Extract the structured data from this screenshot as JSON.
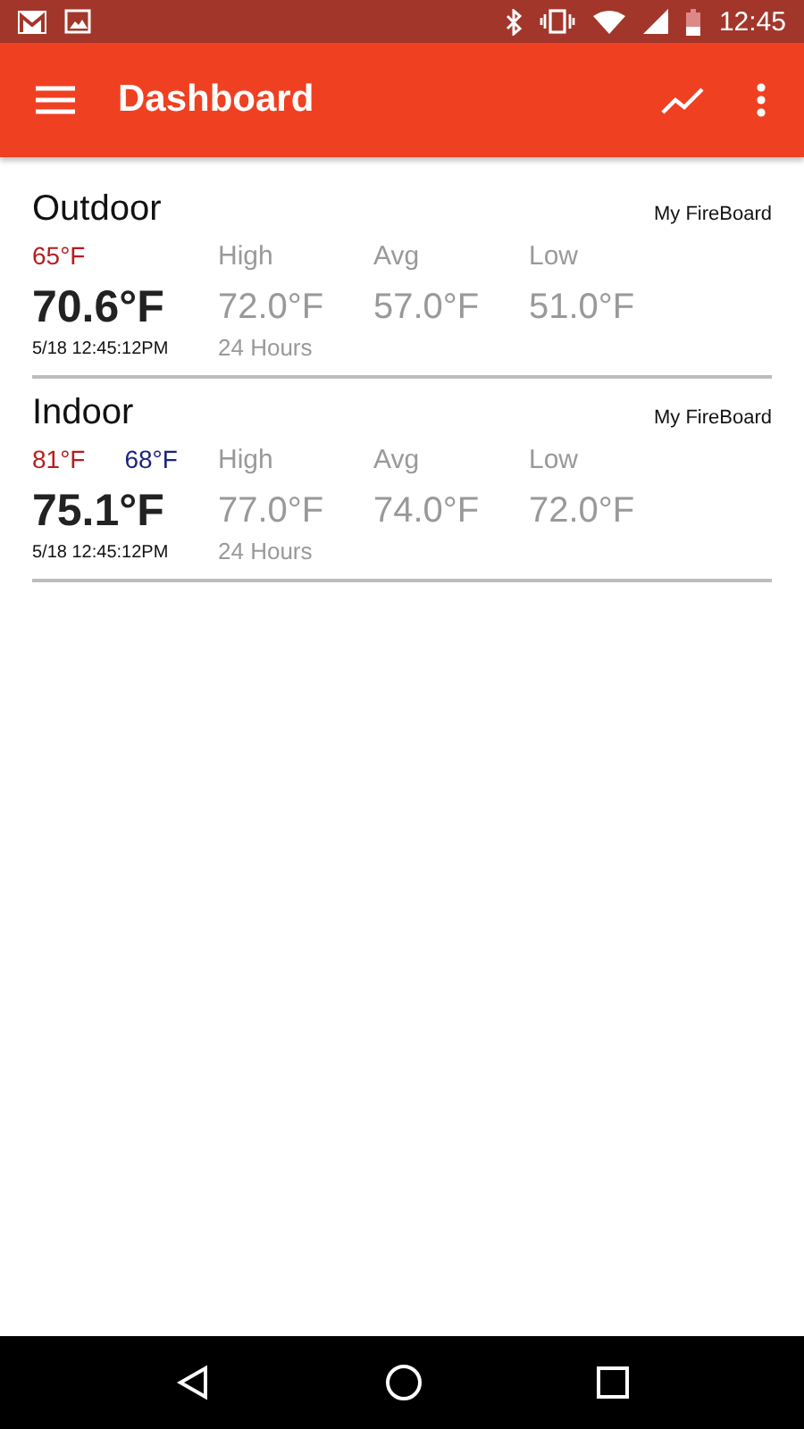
{
  "status_bar": {
    "time": "12:45"
  },
  "app_bar": {
    "title": "Dashboard"
  },
  "sensors": [
    {
      "name": "Outdoor",
      "device": "My FireBoard",
      "alarms": [
        {
          "text": "65°F",
          "color": "#b71c1c"
        }
      ],
      "current": "70.6°F",
      "timestamp": "5/18 12:45:12PM",
      "stats": [
        {
          "label": "High",
          "value": "72.0°F",
          "note": "24 Hours"
        },
        {
          "label": "Avg",
          "value": "57.0°F"
        },
        {
          "label": "Low",
          "value": "51.0°F"
        }
      ]
    },
    {
      "name": "Indoor",
      "device": "My FireBoard",
      "alarms": [
        {
          "text": "81°F",
          "color": "#b71c1c"
        },
        {
          "text": "68°F",
          "color": "#1a237e"
        }
      ],
      "current": "75.1°F",
      "timestamp": "5/18 12:45:12PM",
      "stats": [
        {
          "label": "High",
          "value": "77.0°F",
          "note": "24 Hours"
        },
        {
          "label": "Avg",
          "value": "74.0°F"
        },
        {
          "label": "Low",
          "value": "72.0°F"
        }
      ]
    }
  ]
}
